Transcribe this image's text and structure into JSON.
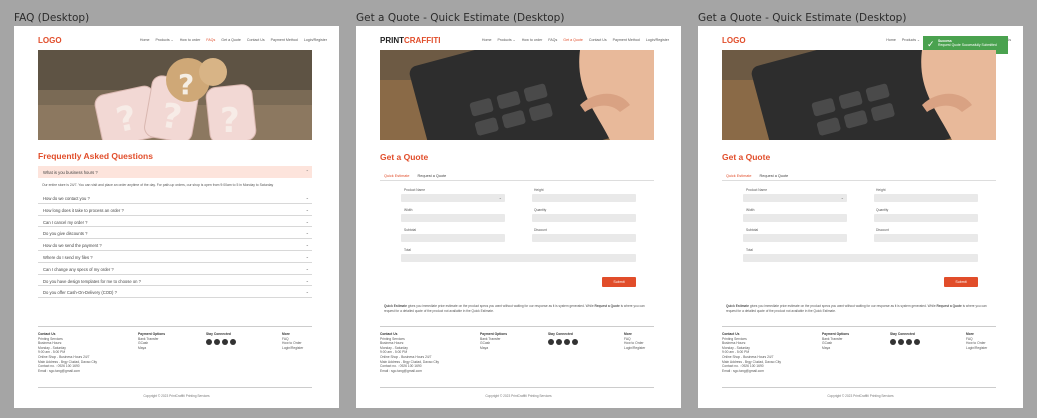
{
  "frames": [
    {
      "title": "FAQ (Desktop)"
    },
    {
      "title": "Get a Quote - Quick Estimate (Desktop)"
    },
    {
      "title": "Get a Quote - Quick Estimate (Desktop)"
    }
  ],
  "header": {
    "logo": "LOGO",
    "logo_brand_a": "PRINT",
    "logo_brand_b": "CRAFFITI",
    "nav": [
      "Home",
      "Products ⌄",
      "How to order",
      "FAQs",
      "Get a Quote",
      "Contact Us",
      "Payment Method",
      "Login/Register"
    ]
  },
  "faq": {
    "heading": "Frequently Asked Questions",
    "open_question": "What is you business hours ?",
    "open_answer": "Our entire store is 24/7. You can visit and place an order anytime of the day. For path-up orders, our shop is open from 9:00am to 5 in Monday to Saturday",
    "questions": [
      "How do we contact you ?",
      "How long does it take to process an order ?",
      "Can I cancel my order ?",
      "Do you give discounts ?",
      "How do we send the payment ?",
      "Where do I send my files ?",
      "Can I change any specs of my order ?",
      "Do you have design templates for me to choose on ?",
      "Do you offer Cash-On-Delivery (COD) ?"
    ]
  },
  "quote": {
    "heading": "Get a Quote",
    "tabs": [
      "Quick Estimate",
      "Request a Quote"
    ],
    "fields": {
      "product_name": "Product Name",
      "height": "Height",
      "width": "Width",
      "quantity": "Quantity",
      "subtotal": "Subtotal",
      "discount": "Discount",
      "total": "Total"
    },
    "submit": "Submit",
    "note_bold_a": "Quick Estimate",
    "note_text": " gives you immediate price estimate on the product specs you want without waiting for our response as it is system generated. While ",
    "note_bold_b": "Request a Quote",
    "note_text_2": " is where you can request for a detailed quote of the product not available in the Quick Estimate."
  },
  "toast": {
    "title": "Success",
    "message": "Request Quote Successfully Submitted"
  },
  "footer": {
    "contact": {
      "title": "Contact Us",
      "lines": [
        "Printing Services",
        "Business Hours:",
        "Monday - Saturday",
        "9:00 am - 5:00 PM",
        "Online Shop - Business Hours 24/7",
        "Main Address - Brgy Ciudad, Davao City",
        "Contact no. : 0926 100 1690",
        "Email : sgo.tang@gmail.com"
      ]
    },
    "payment": {
      "title": "Payment Options",
      "lines": [
        "Bank Transfer",
        "GCash",
        "Maya"
      ]
    },
    "connected": {
      "title": "Stay Connected"
    },
    "more": {
      "title": "More",
      "lines": [
        "FAQ",
        "How to Order",
        "Login/Register"
      ]
    },
    "copyright": "Copyright © 2023 PrintCraffiti Printing Services"
  },
  "colors": {
    "accent": "#e14d2a",
    "success": "#4aa24f"
  }
}
